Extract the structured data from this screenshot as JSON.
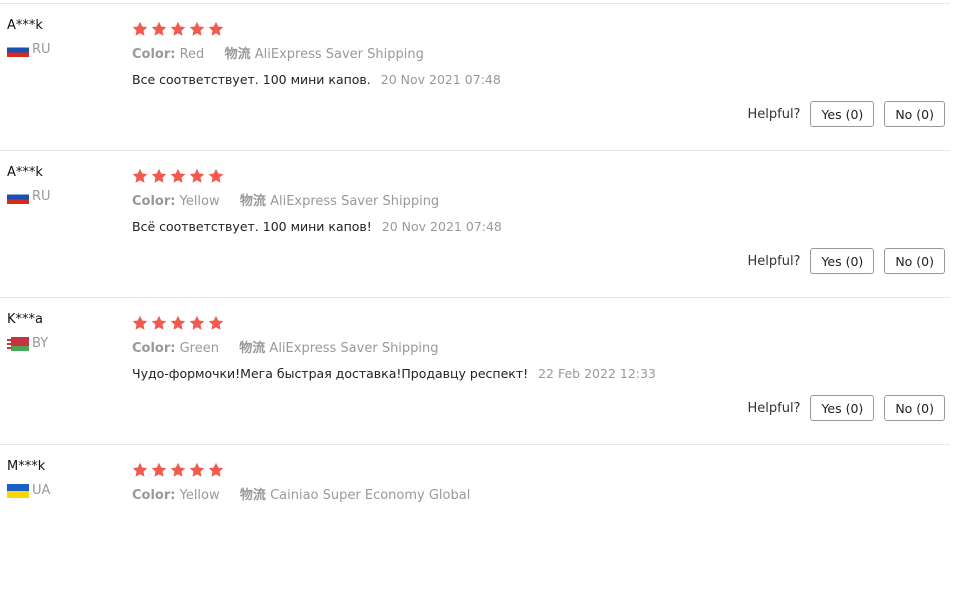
{
  "helpful_label": "Helpful?",
  "color_key": "Color:",
  "logistics_key": "物流",
  "star_color": "#f25a50",
  "reviews": [
    {
      "user": "A***k",
      "country": "RU",
      "flag": "ru",
      "rating": 5,
      "color": "Red",
      "logistics": "AliExpress Saver Shipping",
      "text": "Все соответствует. 100 мини капов.",
      "date": "20 Nov 2021 07:48",
      "yes": "Yes (0)",
      "no": "No (0)"
    },
    {
      "user": "A***k",
      "country": "RU",
      "flag": "ru",
      "rating": 5,
      "color": "Yellow",
      "logistics": "AliExpress Saver Shipping",
      "text": "Всё соответствует. 100 мини капов!",
      "date": "20 Nov 2021 07:48",
      "yes": "Yes (0)",
      "no": "No (0)"
    },
    {
      "user": "K***a",
      "country": "BY",
      "flag": "by",
      "rating": 5,
      "color": "Green",
      "logistics": "AliExpress Saver Shipping",
      "text": "Чудо-формочки!Мега быстрая доставка!Продавцу респект!",
      "date": "22 Feb 2022 12:33",
      "yes": "Yes (0)",
      "no": "No (0)"
    },
    {
      "user": "M***k",
      "country": "UA",
      "flag": "ua",
      "rating": 5,
      "color": "Yellow",
      "logistics": "Cainiao Super Economy Global",
      "text": "",
      "date": "",
      "yes": "",
      "no": ""
    }
  ]
}
